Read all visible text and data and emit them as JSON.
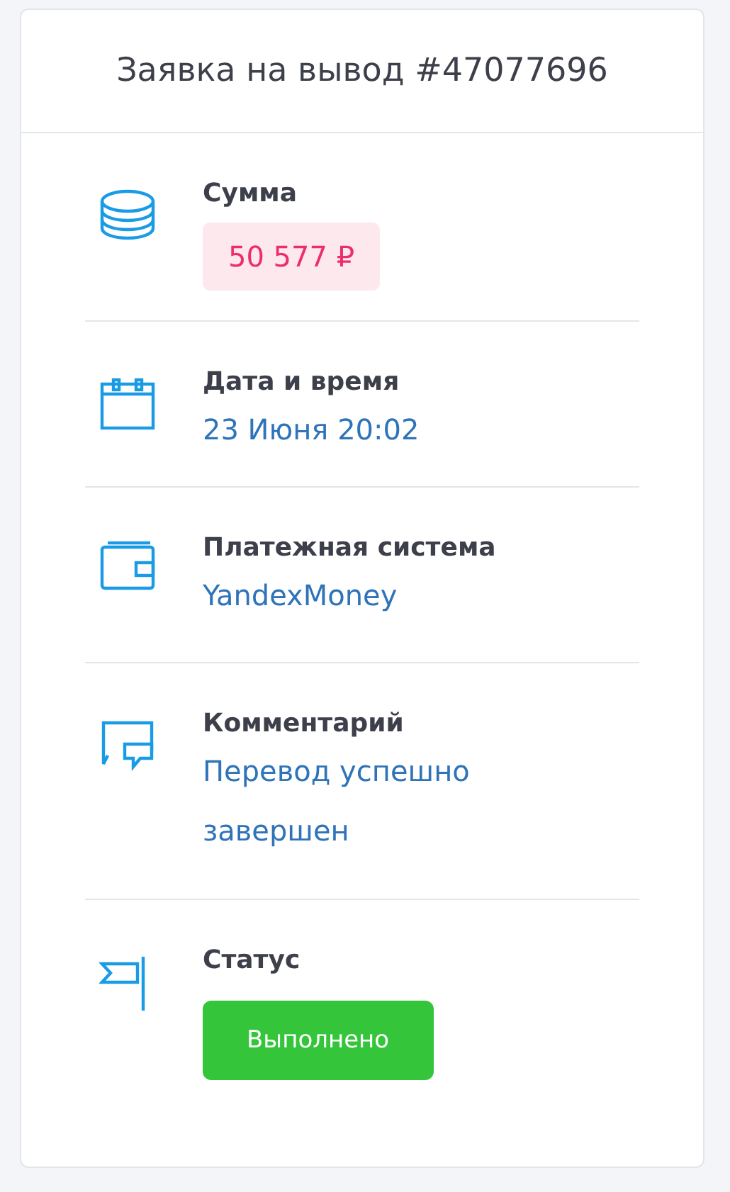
{
  "title": "Заявка на вывод #47077696",
  "rows": [
    {
      "kind": "amount",
      "label": "Сумма",
      "value": "50 577 ₽"
    },
    {
      "kind": "date",
      "label": "Дата и время",
      "value": "23 Июня 20:02"
    },
    {
      "kind": "wallet",
      "label": "Платежная система",
      "value": "YandexMoney"
    },
    {
      "kind": "comment",
      "label": "Комментарий",
      "value": "Перевод успешно завершен"
    },
    {
      "kind": "status",
      "label": "Статус",
      "value": "Выполнено"
    }
  ]
}
